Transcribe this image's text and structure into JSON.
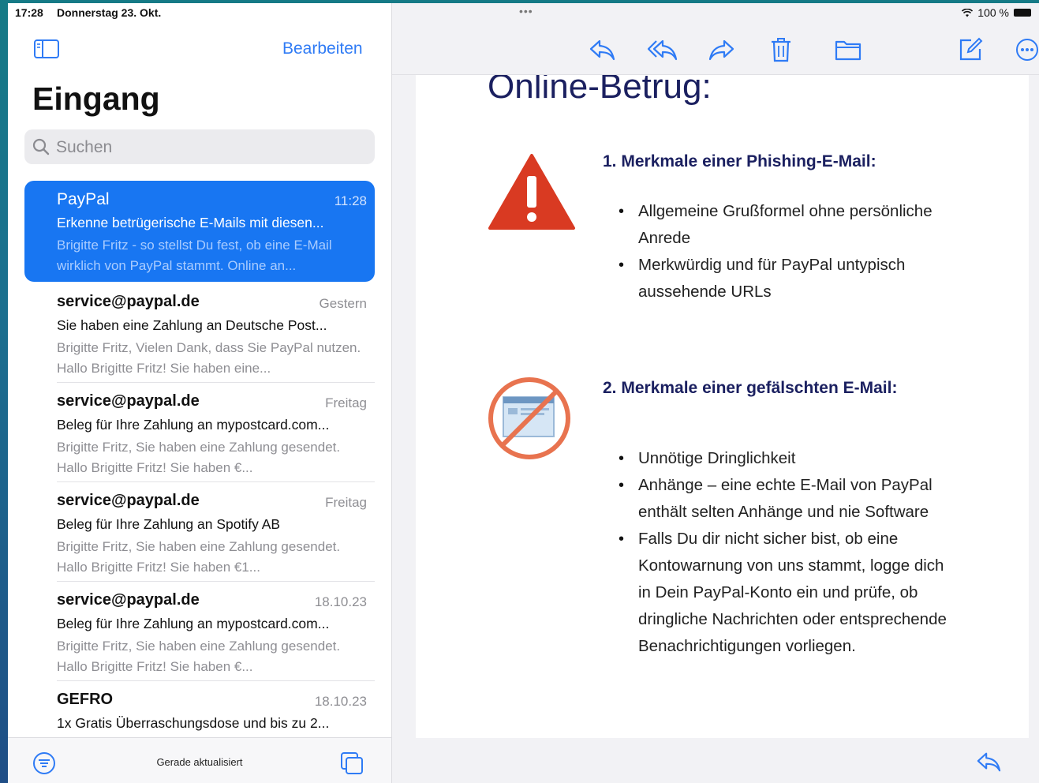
{
  "status_bar": {
    "time": "17:28",
    "date": "Donnerstag 23. Okt.",
    "battery": "100 %"
  },
  "sidebar": {
    "edit_label": "Bearbeiten",
    "title": "Eingang",
    "search_placeholder": "Suchen",
    "footer_status": "Gerade aktualisiert",
    "mails": [
      {
        "sender": "PayPal",
        "date": "11:28",
        "subject": "Erkenne betrügerische E-Mails mit diesen...",
        "preview": "Brigitte Fritz - so stellst Du fest, ob eine E-Mail wirklich von PayPal stammt. Online an...",
        "selected": true
      },
      {
        "sender": "service@paypal.de",
        "date": "Gestern",
        "subject": "Sie haben eine Zahlung an Deutsche Post...",
        "preview": "Brigitte Fritz, Vielen Dank, dass Sie PayPal nutzen. Hallo Brigitte Fritz! Sie haben eine..."
      },
      {
        "sender": "service@paypal.de",
        "date": "Freitag",
        "subject": "Beleg für Ihre Zahlung an mypostcard.com...",
        "preview": "Brigitte Fritz, Sie haben eine Zahlung gesendet. Hallo Brigitte Fritz! Sie haben €..."
      },
      {
        "sender": "service@paypal.de",
        "date": "Freitag",
        "subject": "Beleg für Ihre Zahlung an Spotify AB",
        "preview": "Brigitte Fritz, Sie haben eine Zahlung gesendet. Hallo Brigitte Fritz! Sie haben €1..."
      },
      {
        "sender": "service@paypal.de",
        "date": "18.10.23",
        "subject": "Beleg für Ihre Zahlung an mypostcard.com...",
        "preview": "Brigitte Fritz, Sie haben eine Zahlung gesendet. Hallo Brigitte Fritz! Sie haben €..."
      },
      {
        "sender": "GEFRO",
        "date": "18.10.23",
        "subject": "1x Gratis Überraschungsdose und bis zu 2...",
        "preview": ""
      }
    ]
  },
  "detail": {
    "headline": "Online-Betrug:",
    "section1": {
      "title": "1. Merkmale einer Phishing-E-Mail:",
      "bullets": [
        "Allgemeine Grußformel ohne persönliche Anrede",
        "Merkwürdig und für PayPal untypisch aussehende URLs"
      ]
    },
    "section2": {
      "title": "2. Merkmale einer gefälschten E-Mail:",
      "bullets": [
        "Unnötige Dringlichkeit",
        "Anhänge – eine echte E-Mail von PayPal enthält selten Anhänge und nie Software",
        "Falls Du dir nicht sicher bist, ob eine Kontowarnung von uns stammt, logge dich in Dein PayPal-Konto ein und prüfe, ob dringliche Nachrichten oder entsprechende Benachrichtigungen vorliegen."
      ]
    }
  },
  "colors": {
    "accent": "#2f7bf5",
    "selected_bg": "#1876f2",
    "headline": "#1b2060",
    "warning_red": "#d93a22",
    "forbidden_red": "#e8734f"
  }
}
